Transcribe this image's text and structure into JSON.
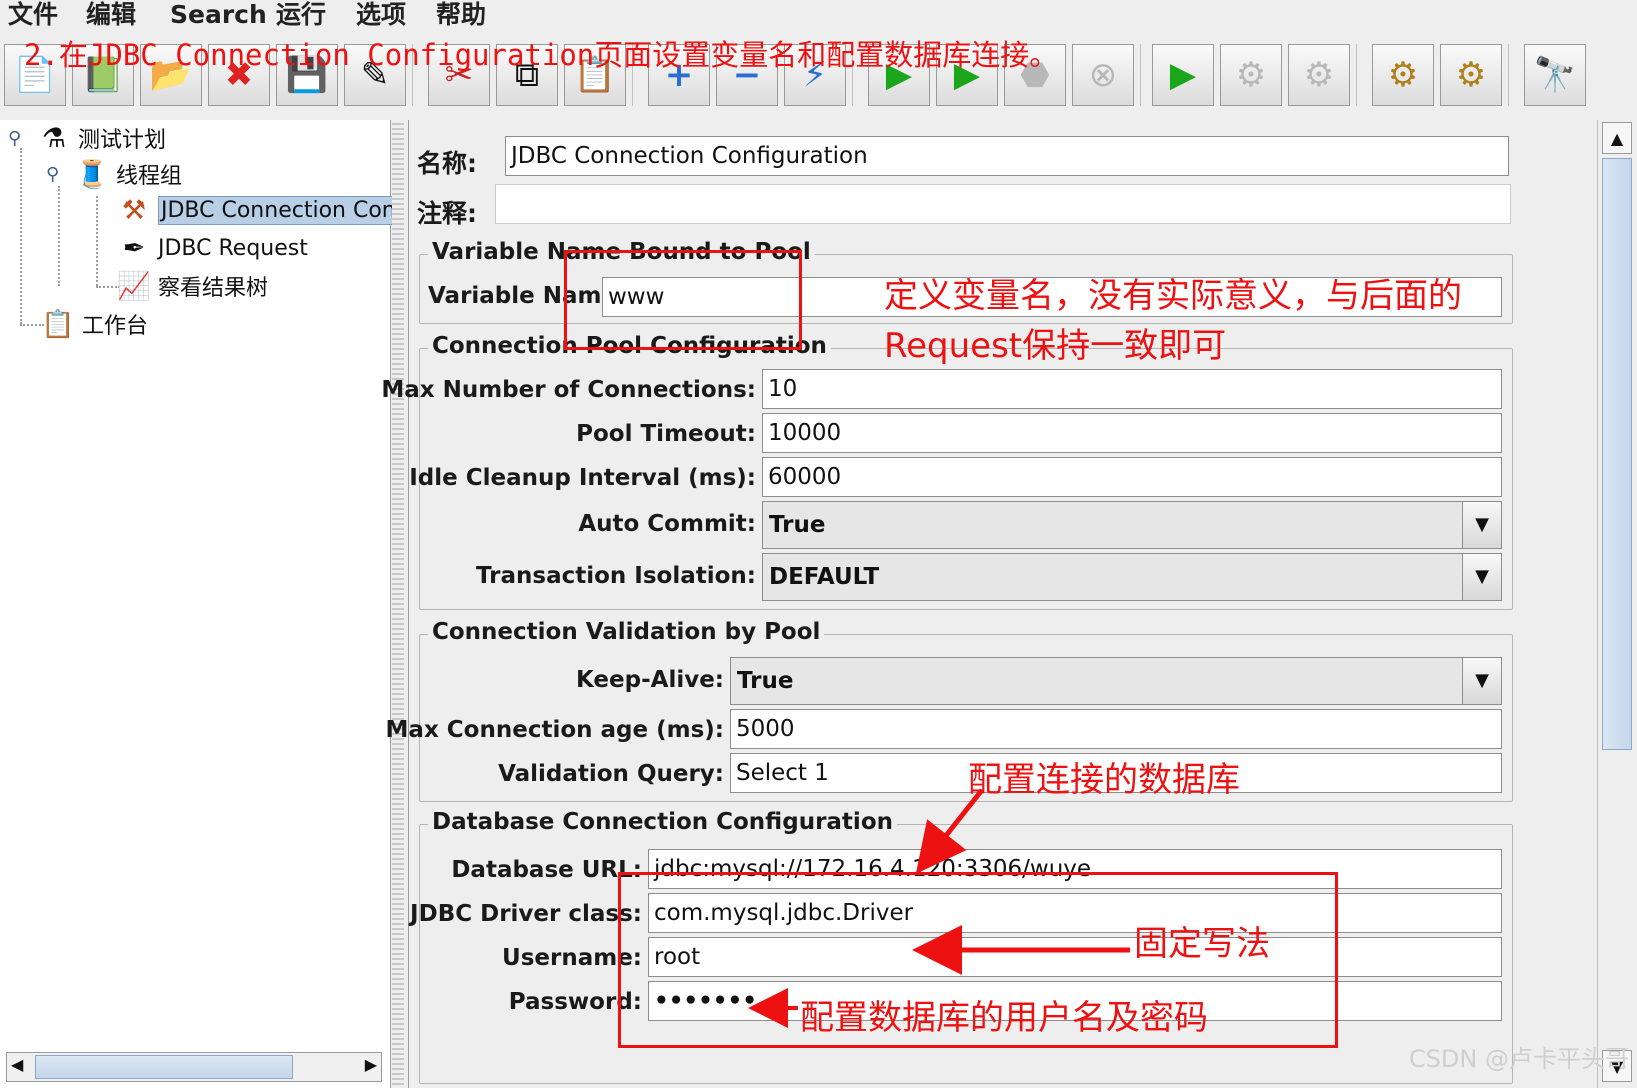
{
  "menu": [
    "文件",
    "编辑",
    "Search",
    "运行",
    "选项",
    "帮助"
  ],
  "instruction": "2.在JDBC Connection Configuration页面设置变量名和配置数据库连接。",
  "toolbar": {
    "icons": [
      "new-icon",
      "templates-icon",
      "open-icon",
      "close-icon",
      "save-icon",
      "save-as-icon",
      "cut-icon",
      "copy-icon",
      "paste-icon",
      "expand-icon",
      "collapse-icon",
      "toggle-icon",
      "start-icon",
      "start-no-pause-icon",
      "stop-icon",
      "shutdown-icon",
      "remote-start-icon",
      "remote-stop-icon",
      "remote-shutdown-icon",
      "clear-icon",
      "clear-all-icon",
      "search-icon"
    ]
  },
  "tree": {
    "nodes": [
      {
        "label": "测试计划",
        "icon": "test-plan-icon"
      },
      {
        "label": "线程组",
        "icon": "thread-group-icon"
      },
      {
        "label": "JDBC Connection Con",
        "icon": "jdbc-config-icon",
        "selected": true
      },
      {
        "label": "JDBC Request",
        "icon": "sampler-icon"
      },
      {
        "label": "察看结果树",
        "icon": "listener-icon"
      },
      {
        "label": "工作台",
        "icon": "workbench-icon"
      }
    ]
  },
  "form": {
    "name_label": "名称:",
    "name_value": "JDBC Connection Configuration",
    "comment_label": "注释:",
    "comment_value": "",
    "variable_group": {
      "title": "Variable Name Bound to Pool",
      "variable_label": "Variable Name:",
      "variable_value": "www"
    },
    "pool_group": {
      "title": "Connection Pool Configuration",
      "max_conn_label": "Max Number of Connections:",
      "max_conn_value": "10",
      "timeout_label": "Pool Timeout:",
      "timeout_value": "10000",
      "idle_label": "Idle Cleanup Interval (ms):",
      "idle_value": "60000",
      "autocommit_label": "Auto Commit:",
      "autocommit_value": "True",
      "isolation_label": "Transaction Isolation:",
      "isolation_value": "DEFAULT"
    },
    "validation_group": {
      "title": "Connection Validation by Pool",
      "keepalive_label": "Keep-Alive:",
      "keepalive_value": "True",
      "max_age_label": "Max Connection age (ms):",
      "max_age_value": "5000",
      "query_label": "Validation Query:",
      "query_value": "Select 1"
    },
    "db_group": {
      "title": "Database Connection Configuration",
      "url_label": "Database URL:",
      "url_value": "jdbc:mysql://172.16.4.120:3306/wuye",
      "driver_label": "JDBC Driver class:",
      "driver_value": "com.mysql.jdbc.Driver",
      "user_label": "Username:",
      "user_value": "root",
      "password_label": "Password:",
      "password_value": "•••••••"
    }
  },
  "annotations": {
    "variable_note_line1": "定义变量名，没有实际意义，与后面的",
    "variable_note_line2": "Request保持一致即可",
    "db_note": "配置连接的数据库",
    "driver_note": "固定写法",
    "credentials_note": "配置数据库的用户名及密码",
    "color": "#ee1111"
  },
  "watermark": "CSDN @卢卡平头哥",
  "colors": {
    "background": "#eeeeee",
    "selection": "#b8cfe5",
    "annotation_red": "#ee1111"
  }
}
